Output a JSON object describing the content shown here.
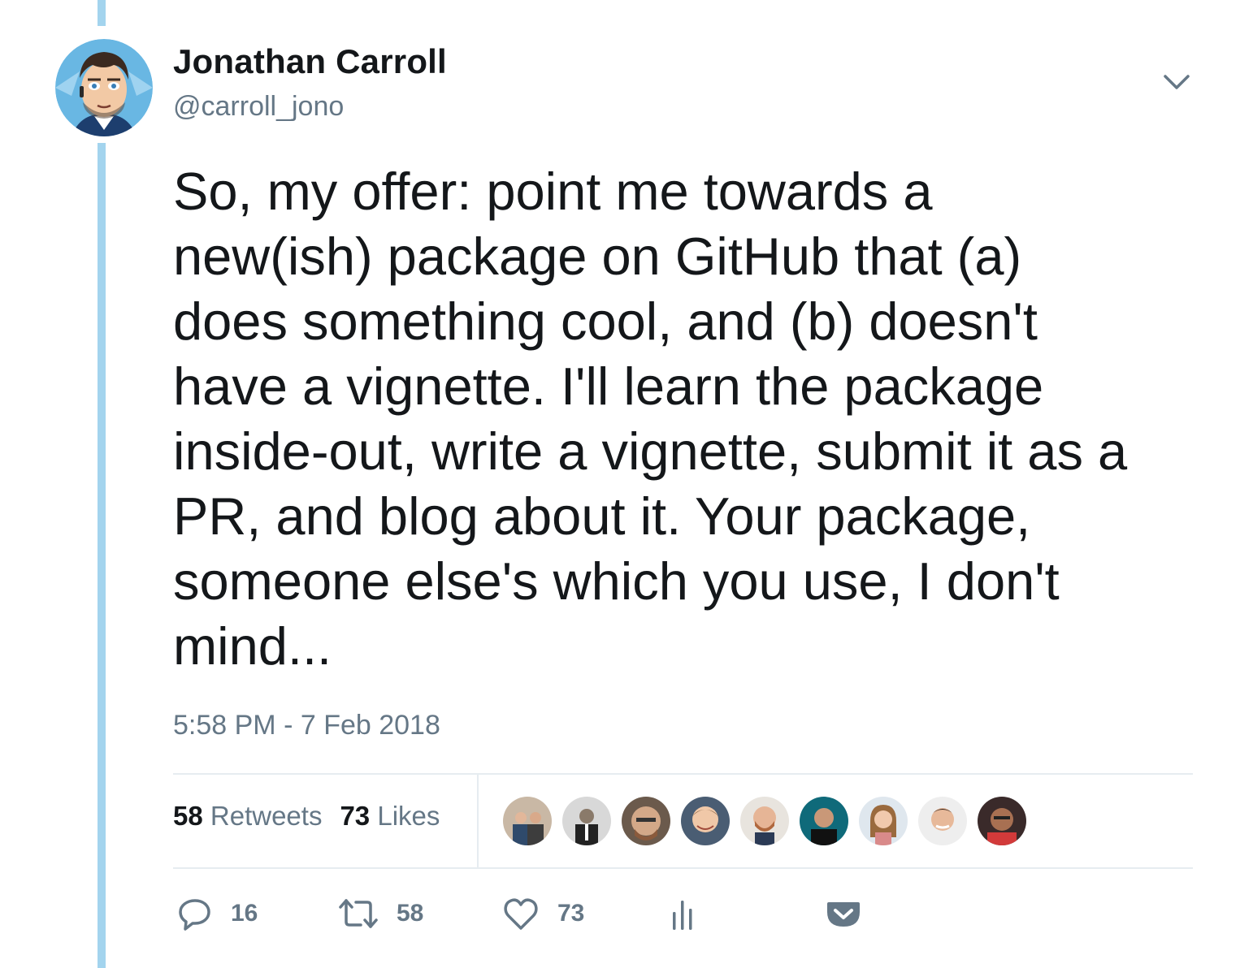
{
  "author": {
    "name": "Jonathan Carroll",
    "handle": "@carroll_jono",
    "avatar_icon": "cartoon-face-avatar"
  },
  "tweet": {
    "lines": [
      "So, my offer: point me towards a",
      "new(ish) package on GitHub that (a)",
      "does something cool, and (b) doesn't",
      "have a vignette. I'll learn the package",
      "inside-out, write a vignette, submit it as a",
      "PR, and blog about it. Your package,",
      "someone else's which you use, I don't",
      "mind..."
    ],
    "timestamp": "5:58 PM - 7 Feb 2018"
  },
  "stats": {
    "retweets_count": "58",
    "retweets_label": "Retweets",
    "likes_count": "73",
    "likes_label": "Likes"
  },
  "actions": {
    "reply_count": "16",
    "retweet_count": "58",
    "like_count": "73"
  },
  "icons": {
    "caret": "chevron-down-icon",
    "reply": "reply-icon",
    "retweet": "retweet-icon",
    "like": "heart-icon",
    "analytics": "analytics-icon",
    "pocket": "pocket-icon"
  },
  "colors": {
    "thread_line": "#a3d4ee",
    "text": "#14171a",
    "secondary": "#657786",
    "divider": "#e6ecf0",
    "pocket": "#657786"
  }
}
